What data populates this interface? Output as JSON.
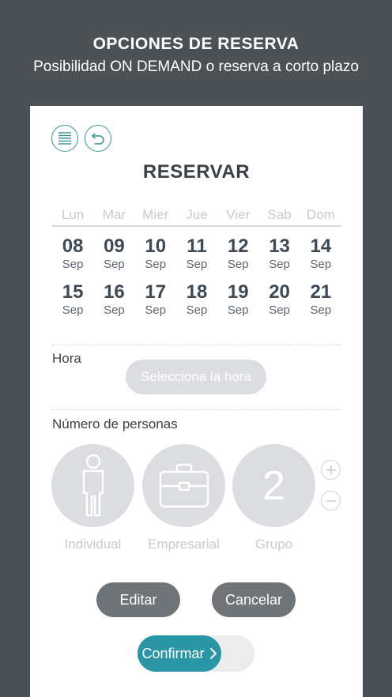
{
  "header": {
    "title": "OPCIONES DE RESERVA",
    "subtitle": "Posibilidad ON DEMAND o reserva a corto plazo"
  },
  "card": {
    "title": "RESERVAR",
    "weekdays": [
      "Lun",
      "Mar",
      "Mier",
      "Jue",
      "Vier",
      "Sab",
      "Dom"
    ],
    "dates": [
      [
        {
          "day": "08",
          "month": "Sep"
        },
        {
          "day": "09",
          "month": "Sep"
        },
        {
          "day": "10",
          "month": "Sep"
        },
        {
          "day": "11",
          "month": "Sep"
        },
        {
          "day": "12",
          "month": "Sep"
        },
        {
          "day": "13",
          "month": "Sep"
        },
        {
          "day": "14",
          "month": "Sep"
        }
      ],
      [
        {
          "day": "15",
          "month": "Sep"
        },
        {
          "day": "16",
          "month": "Sep"
        },
        {
          "day": "17",
          "month": "Sep"
        },
        {
          "day": "18",
          "month": "Sep"
        },
        {
          "day": "19",
          "month": "Sep"
        },
        {
          "day": "20",
          "month": "Sep"
        },
        {
          "day": "21",
          "month": "Sep"
        }
      ]
    ],
    "hour_label": "Hora",
    "hour_button": "Selecciona la hora",
    "people_label": "Número de personas",
    "options": {
      "individual": "Individual",
      "empresarial": "Empresarial",
      "grupo": "Grupo",
      "group_count": "2"
    },
    "edit_button": "Editar",
    "cancel_button": "Cancelar",
    "confirm_button": "Confirmar"
  },
  "colors": {
    "background": "#4b5154",
    "accent": "#2a96a5",
    "icon_outline": "#3a8f92",
    "disabled": "#dcdde0",
    "action_gray": "#6f7478"
  },
  "icons": [
    "menu-icon",
    "back-icon",
    "person-icon",
    "briefcase-icon",
    "plus-icon",
    "minus-icon",
    "chevron-right-icon"
  ]
}
